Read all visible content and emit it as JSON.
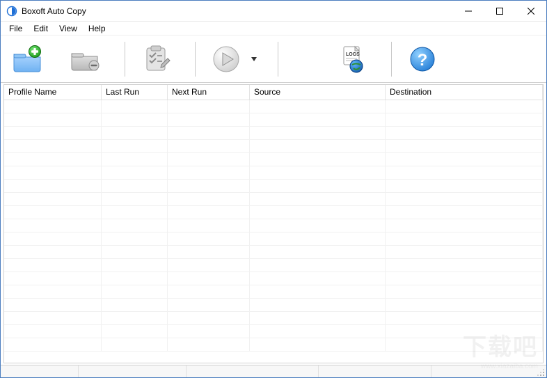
{
  "app": {
    "title": "Boxoft Auto Copy"
  },
  "menu": {
    "file": "File",
    "edit": "Edit",
    "view": "View",
    "help": "Help"
  },
  "toolbar": {
    "new_profile_icon": "folder-plus-icon",
    "remove_profile_icon": "folder-minus-icon",
    "edit_profile_icon": "clipboard-check-icon",
    "run_icon": "play-icon",
    "logs_icon": "logs-globe-icon",
    "help_icon": "help-icon"
  },
  "columns": {
    "profile_name": "Profile Name",
    "last_run": "Last Run",
    "next_run": "Next Run",
    "source": "Source",
    "destination": "Destination"
  },
  "rows": [],
  "watermark": {
    "main": "下载吧",
    "sub": "www.xiazaiba.com"
  }
}
